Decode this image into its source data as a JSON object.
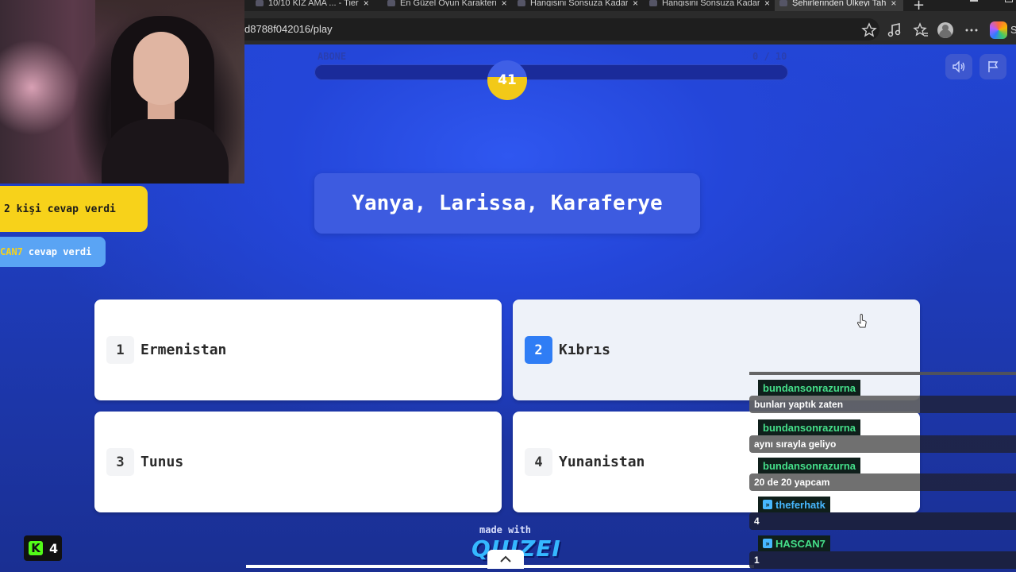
{
  "browser": {
    "tabs": [
      {
        "title": "10/10 KIZ AMA ... - Tier"
      },
      {
        "title": "En Güzel Oyun Karakteri"
      },
      {
        "title": "Hangisini Sonsuza Kadar"
      },
      {
        "title": "Hangisini Sonsuza Kadar"
      },
      {
        "title": "Şehirlerinden Ülkeyi Tah"
      }
    ],
    "url": "d8788f042016/play",
    "icons": [
      "star-icon",
      "music-icon",
      "favorites-icon",
      "profile-icon",
      "more-icon",
      "copilot-icon"
    ],
    "partial_label": "S"
  },
  "game": {
    "progress_left_label": "ABONE",
    "progress_right_label": "0 / 10",
    "progress_fraction": 0.0,
    "timer": "41",
    "question": "Yanya, Larissa, Karaferye",
    "answers": [
      {
        "num": "1",
        "label": "Ermenistan",
        "selected": false
      },
      {
        "num": "2",
        "label": "Kıbrıs",
        "selected": true
      },
      {
        "num": "3",
        "label": "Tunus",
        "selected": false
      },
      {
        "num": "4",
        "label": "Yunanistan",
        "selected": false
      }
    ],
    "made_with": "made with",
    "brand": "QUIZEI",
    "colors": {
      "accent_blue": "#2f7df5",
      "timer_yellow": "#f2c918",
      "background": "#1e3bb8"
    }
  },
  "overlay": {
    "answered_count": "2 kişi cevap verdi",
    "answered_user_name": "CAN7",
    "answered_user_suffix": "cevap verdi",
    "viewer_count": "4",
    "kick_logo": "K"
  },
  "chat": {
    "messages": [
      {
        "user": "bundansonrazurna",
        "text": "bunları yaptık zaten"
      },
      {
        "user": "bundansonrazurna",
        "text": "aynı sırayla geliyo"
      },
      {
        "user": "bundansonrazurna",
        "text": "20 de 20 yapcam"
      },
      {
        "user": "theferhatk",
        "text": "4"
      },
      {
        "user": "HASCAN7",
        "text": "1"
      }
    ]
  }
}
